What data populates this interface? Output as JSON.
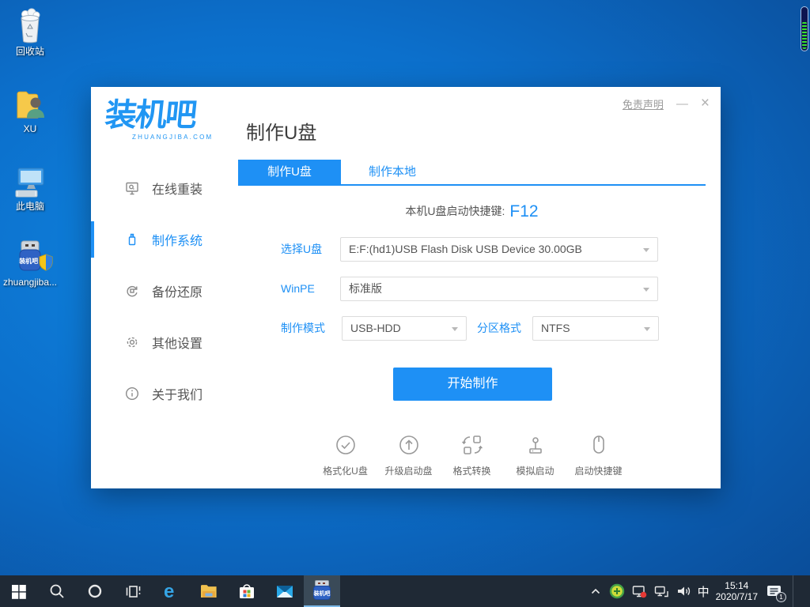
{
  "accent": "#1e90f5",
  "desktop_icons": [
    {
      "label": "回收站"
    },
    {
      "label": "XU"
    },
    {
      "label": "此电脑"
    },
    {
      "label": "zhuangjiba...",
      "icon_text": "装机吧"
    }
  ],
  "window": {
    "logo_title": "装机吧",
    "logo_subtitle": "ZHUANGJIBA.COM",
    "page_title": "制作U盘",
    "disclaimer": "免责声明",
    "minimize_glyph": "—",
    "close_glyph": "×",
    "sidebar": [
      {
        "label": "在线重装",
        "active": false
      },
      {
        "label": "制作系统",
        "active": true
      },
      {
        "label": "备份还原",
        "active": false
      },
      {
        "label": "其他设置",
        "active": false
      },
      {
        "label": "关于我们",
        "active": false
      }
    ],
    "tabs": [
      {
        "label": "制作U盘",
        "active": true
      },
      {
        "label": "制作本地",
        "active": false
      }
    ],
    "hotkey_label": "本机U盘启动快捷键:",
    "hotkey_value": "F12",
    "fields": {
      "usb": {
        "label": "选择U盘",
        "value": "E:F:(hd1)USB Flash Disk USB Device 30.00GB"
      },
      "winpe": {
        "label": "WinPE",
        "value": "标准版"
      },
      "mode": {
        "label": "制作模式",
        "value": "USB-HDD"
      },
      "partition": {
        "label": "分区格式",
        "value": "NTFS"
      }
    },
    "start_button": "开始制作",
    "tools": [
      {
        "label": "格式化U盘"
      },
      {
        "label": "升级启动盘"
      },
      {
        "label": "格式转换"
      },
      {
        "label": "模拟启动"
      },
      {
        "label": "启动快捷键"
      }
    ]
  },
  "taskbar": {
    "edge_glyph": "e",
    "app_icon_text": "装机吧",
    "ime": "中",
    "time": "15:14",
    "date": "2020/7/17",
    "notification_count": "1"
  }
}
